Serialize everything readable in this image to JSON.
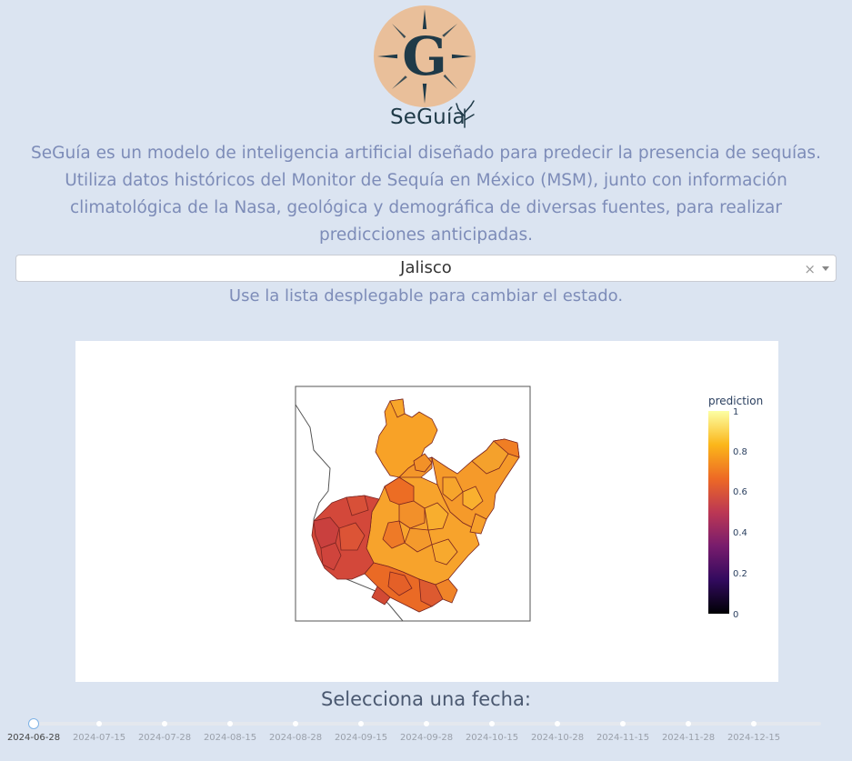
{
  "brand": {
    "name": "SeGuía",
    "logo_letter": "G",
    "logo_color": "#e9bf9a",
    "logo_ink": "#1f3a48"
  },
  "description": "SeGuía es un modelo de inteligencia artificial diseñado para predecir la presencia de sequías. Utiliza datos históricos del Monitor de Sequía en México (MSM), junto con información climatológica de la Nasa, geológica y demográfica de diversas fuentes, para realizar predicciones anticipadas.",
  "state_select": {
    "value": "Jalisco",
    "clear_glyph": "×",
    "hint": "Use la lista desplegable para cambiar el estado."
  },
  "map": {
    "colorbar_title": "prediction",
    "colorbar_ticks": [
      "1",
      "0.8",
      "0.6",
      "0.4",
      "0.2",
      "0"
    ],
    "colorscale": [
      "#000004",
      "#320a5e",
      "#781c6d",
      "#bc3754",
      "#ed6925",
      "#fbb61a",
      "#fcffa4"
    ]
  },
  "date_slider": {
    "label": "Selecciona una fecha:",
    "marks": [
      "2024-06-28",
      "2024-07-15",
      "2024-07-28",
      "2024-08-15",
      "2024-08-28",
      "2024-09-15",
      "2024-09-28",
      "2024-10-15",
      "2024-10-28",
      "2024-11-15",
      "2024-11-28",
      "2024-12-15"
    ],
    "selected": "2024-06-28"
  }
}
